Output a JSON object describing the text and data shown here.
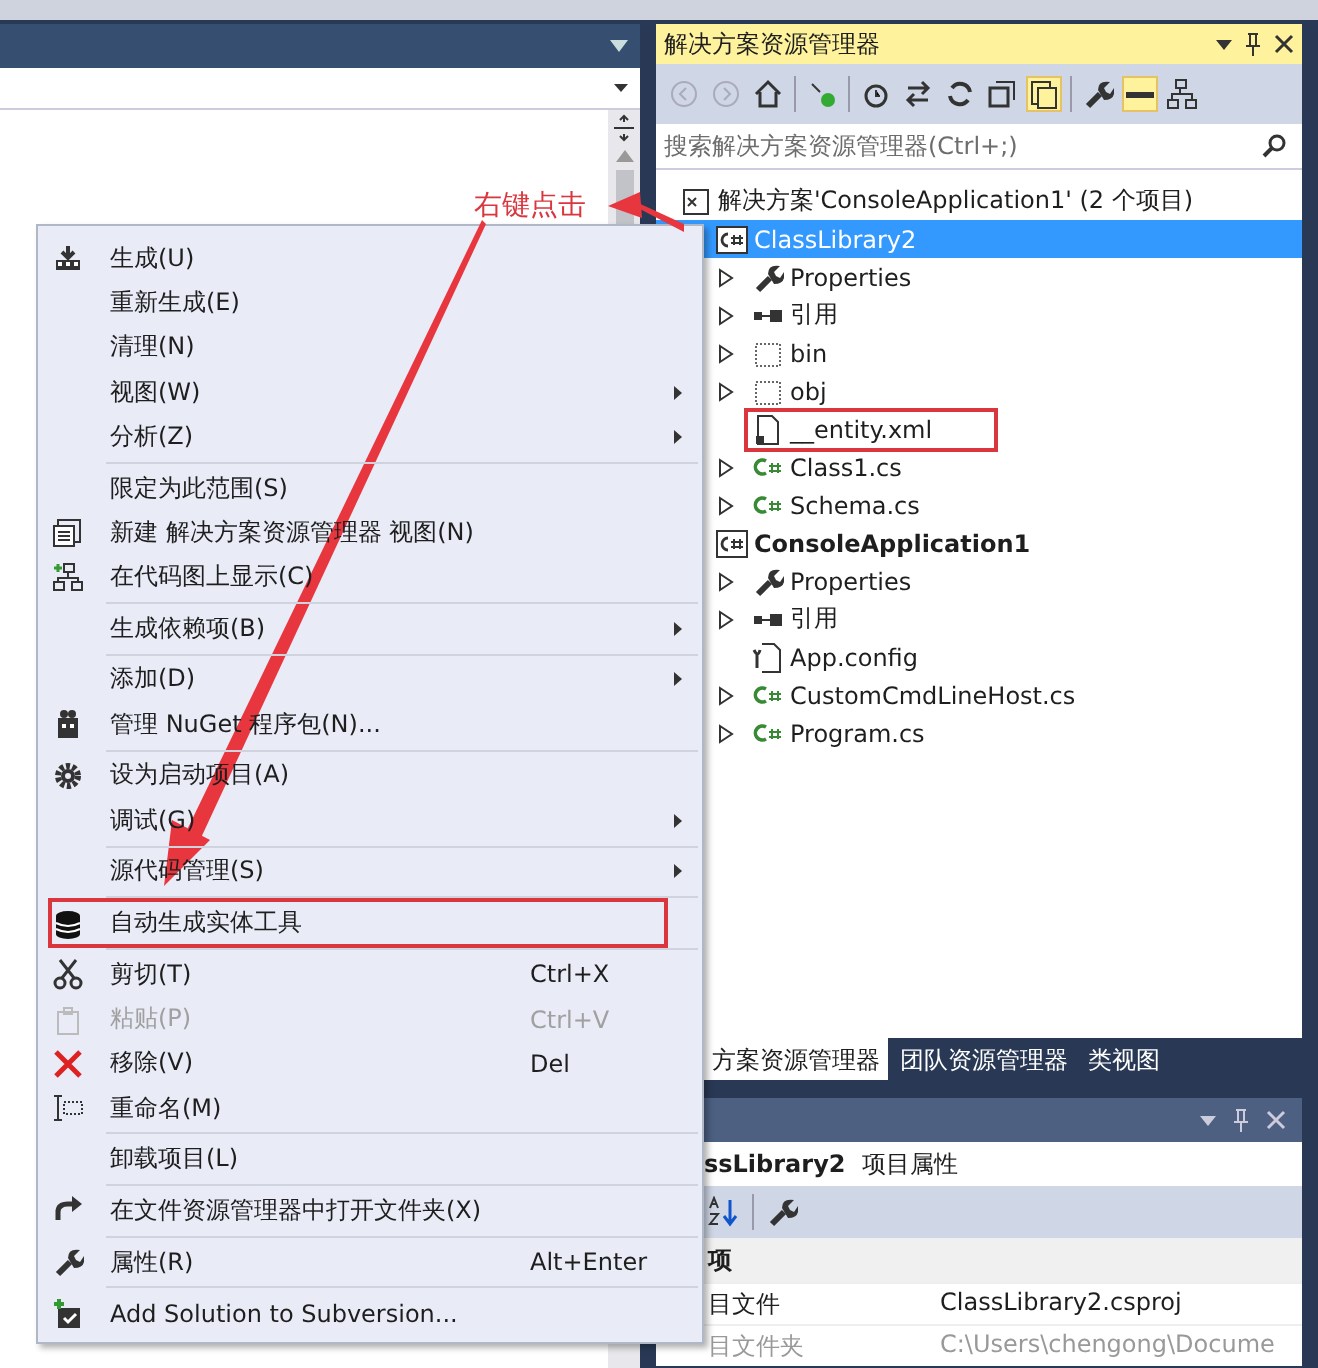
{
  "solution_explorer": {
    "title": "解决方案资源管理器",
    "search": {
      "placeholder": "搜索解决方案资源管理器(Ctrl+;)"
    },
    "tree": [
      {
        "label": "解决方案'ConsoleApplication1' (2 个项目)",
        "kind": "solution",
        "selected": false,
        "bold": false,
        "collapsed": false,
        "highlighted": false,
        "children": [
          {
            "label": "ClassLibrary2",
            "kind": "project",
            "selected": true,
            "bold": false,
            "collapsed": false,
            "highlighted": false,
            "children": [
              {
                "label": "Properties",
                "kind": "wrench",
                "selected": false,
                "bold": false,
                "collapsed": true,
                "highlighted": false
              },
              {
                "label": "引用",
                "kind": "references",
                "selected": false,
                "bold": false,
                "collapsed": true,
                "highlighted": false
              },
              {
                "label": "bin",
                "kind": "dotted-folder",
                "selected": false,
                "bold": false,
                "collapsed": true,
                "highlighted": false
              },
              {
                "label": "obj",
                "kind": "dotted-folder",
                "selected": false,
                "bold": false,
                "collapsed": true,
                "highlighted": false
              },
              {
                "label": "__entity.xml",
                "kind": "file",
                "selected": false,
                "bold": false,
                "collapsed": false,
                "highlighted": true
              },
              {
                "label": "Class1.cs",
                "kind": "csharp",
                "selected": false,
                "bold": false,
                "collapsed": true,
                "highlighted": false
              },
              {
                "label": "Schema.cs",
                "kind": "csharp",
                "selected": false,
                "bold": false,
                "collapsed": true,
                "highlighted": false
              }
            ]
          },
          {
            "label": "ConsoleApplication1",
            "kind": "project",
            "selected": false,
            "bold": true,
            "collapsed": false,
            "highlighted": false,
            "children": [
              {
                "label": "Properties",
                "kind": "wrench",
                "selected": false,
                "bold": false,
                "collapsed": true,
                "highlighted": false
              },
              {
                "label": "引用",
                "kind": "references",
                "selected": false,
                "bold": false,
                "collapsed": true,
                "highlighted": false
              },
              {
                "label": "App.config",
                "kind": "config",
                "selected": false,
                "bold": false,
                "collapsed": false,
                "highlighted": false
              },
              {
                "label": "CustomCmdLineHost.cs",
                "kind": "csharp",
                "selected": false,
                "bold": false,
                "collapsed": true,
                "highlighted": false
              },
              {
                "label": "Program.cs",
                "kind": "csharp",
                "selected": false,
                "bold": false,
                "collapsed": true,
                "highlighted": false
              }
            ]
          }
        ]
      }
    ]
  },
  "bottom_tabs": [
    {
      "label": "方案资源管理器",
      "selected": true
    },
    {
      "label": "团队资源管理器",
      "selected": false
    },
    {
      "label": "类视图",
      "selected": false
    }
  ],
  "properties": {
    "object": "ssLibrary2",
    "object_type": "项目属性",
    "category": "项",
    "rows": [
      {
        "name": "目文件",
        "value": "ClassLibrary2.csproj",
        "disabled": false
      },
      {
        "name": "目文件夹",
        "value": "C:\\Users\\chengong\\Docume",
        "disabled": true
      }
    ]
  },
  "context_menu": [
    {
      "kind": "build",
      "label": "生成(U)",
      "submenu": false,
      "disabled": false,
      "highlighted": false
    },
    {
      "kind": "plain",
      "label": "重新生成(E)",
      "submenu": false,
      "disabled": false,
      "highlighted": false
    },
    {
      "kind": "plain",
      "label": "清理(N)",
      "submenu": false,
      "disabled": false,
      "highlighted": false
    },
    {
      "kind": "plain",
      "label": "视图(W)",
      "submenu": true,
      "disabled": false,
      "highlighted": false
    },
    {
      "kind": "plain",
      "label": "分析(Z)",
      "submenu": true,
      "disabled": false,
      "highlighted": false
    },
    {
      "kind": "separator"
    },
    {
      "kind": "plain",
      "label": "限定为此范围(S)",
      "submenu": false,
      "disabled": false,
      "highlighted": false
    },
    {
      "kind": "new-view",
      "label": "新建 解决方案资源管理器 视图(N)",
      "submenu": false,
      "disabled": false,
      "highlighted": false
    },
    {
      "kind": "code-map",
      "label": "在代码图上显示(C)",
      "submenu": false,
      "disabled": false,
      "highlighted": false
    },
    {
      "kind": "separator"
    },
    {
      "kind": "plain",
      "label": "生成依赖项(B)",
      "submenu": true,
      "disabled": false,
      "highlighted": false
    },
    {
      "kind": "separator"
    },
    {
      "kind": "plain",
      "label": "添加(D)",
      "submenu": true,
      "disabled": false,
      "highlighted": false
    },
    {
      "kind": "package",
      "label": "管理 NuGet 程序包(N)...",
      "submenu": false,
      "disabled": false,
      "highlighted": false
    },
    {
      "kind": "separator"
    },
    {
      "kind": "gear",
      "label": "设为启动项目(A)",
      "submenu": false,
      "disabled": false,
      "highlighted": false
    },
    {
      "kind": "plain",
      "label": "调试(G)",
      "submenu": true,
      "disabled": false,
      "highlighted": false
    },
    {
      "kind": "separator"
    },
    {
      "kind": "plain",
      "label": "源代码管理(S)",
      "submenu": true,
      "disabled": false,
      "highlighted": false
    },
    {
      "kind": "separator"
    },
    {
      "kind": "database",
      "label": "自动生成实体工具",
      "submenu": false,
      "disabled": false,
      "highlighted": true
    },
    {
      "kind": "separator"
    },
    {
      "kind": "scissors",
      "label": "剪切(T)",
      "shortcut": "Ctrl+X",
      "submenu": false,
      "disabled": false,
      "highlighted": false
    },
    {
      "kind": "paste",
      "label": "粘贴(P)",
      "shortcut": "Ctrl+V",
      "submenu": false,
      "disabled": true,
      "highlighted": false
    },
    {
      "kind": "remove",
      "label": "移除(V)",
      "shortcut": "Del",
      "submenu": false,
      "disabled": false,
      "highlighted": false
    },
    {
      "kind": "rename",
      "label": "重命名(M)",
      "submenu": false,
      "disabled": false,
      "highlighted": false
    },
    {
      "kind": "separator"
    },
    {
      "kind": "plain",
      "label": "卸载项目(L)",
      "submenu": false,
      "disabled": false,
      "highlighted": false
    },
    {
      "kind": "separator"
    },
    {
      "kind": "redo-arrow",
      "label": "在文件资源管理器中打开文件夹(X)",
      "submenu": false,
      "disabled": false,
      "highlighted": false
    },
    {
      "kind": "separator"
    },
    {
      "kind": "wrench",
      "label": "属性(R)",
      "shortcut": "Alt+Enter",
      "submenu": false,
      "disabled": false,
      "highlighted": false
    },
    {
      "kind": "separator"
    },
    {
      "kind": "add-box",
      "label": "Add Solution to Subversion...",
      "submenu": false,
      "disabled": false,
      "highlighted": false
    }
  ],
  "annotation": {
    "label": "右键点击"
  }
}
